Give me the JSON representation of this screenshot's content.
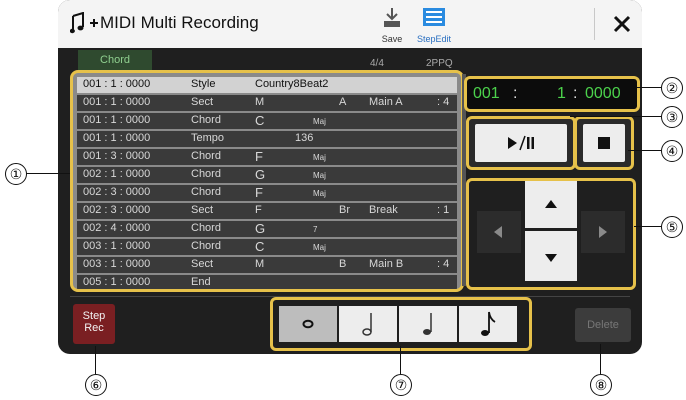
{
  "title": "MIDI Multi Recording",
  "toolbar": {
    "save_label": "Save",
    "stepedit_label": "StepEdit"
  },
  "chord_tab": "Chord",
  "time_signature": "4/4",
  "ppq": "2PPQ",
  "events": [
    {
      "pos": "001 : 1 : 0000",
      "type": "Style",
      "v1": "Country8Beat2",
      "v2": "",
      "v3": "",
      "v4": ""
    },
    {
      "pos": "001 : 1 : 0000",
      "type": "Sect",
      "v1": "M",
      "v2": "A",
      "v3": "Main A",
      "v4": ": 4"
    },
    {
      "pos": "001 : 1 : 0000",
      "type": "Chord",
      "v1": "C",
      "v2": "Maj",
      "v3": "",
      "v4": ""
    },
    {
      "pos": "001 : 1 : 0000",
      "type": "Tempo",
      "v1": "136",
      "v2": "",
      "v3": "",
      "v4": ""
    },
    {
      "pos": "001 : 3 : 0000",
      "type": "Chord",
      "v1": "F",
      "v2": "Maj",
      "v3": "",
      "v4": ""
    },
    {
      "pos": "002 : 1 : 0000",
      "type": "Chord",
      "v1": "G",
      "v2": "Maj",
      "v3": "",
      "v4": ""
    },
    {
      "pos": "002 : 3 : 0000",
      "type": "Chord",
      "v1": "F",
      "v2": "Maj",
      "v3": "",
      "v4": ""
    },
    {
      "pos": "002 : 3 : 0000",
      "type": "Sect",
      "v1": "F",
      "v2": "Br",
      "v3": "Break",
      "v4": ": 1"
    },
    {
      "pos": "002 : 4 : 0000",
      "type": "Chord",
      "v1": "G",
      "v2": "7",
      "v3": "",
      "v4": ""
    },
    {
      "pos": "003 : 1 : 0000",
      "type": "Chord",
      "v1": "C",
      "v2": "Maj",
      "v3": "",
      "v4": ""
    },
    {
      "pos": "003 : 1 : 0000",
      "type": "Sect",
      "v1": "M",
      "v2": "B",
      "v3": "Main B",
      "v4": ": 4"
    },
    {
      "pos": "005 : 1 : 0000",
      "type": "End",
      "v1": "",
      "v2": "",
      "v3": "",
      "v4": ""
    }
  ],
  "counter": {
    "measure": "001",
    "beat": "1",
    "clock": "0000"
  },
  "step_rec_label": [
    "Step",
    "Rec"
  ],
  "delete_label": "Delete",
  "callouts": [
    "①",
    "②",
    "③",
    "④",
    "⑤",
    "⑥",
    "⑦",
    "⑧"
  ],
  "colors": {
    "highlight": "#e6c14a",
    "counter_text": "#4cd24c",
    "step_rec_bg": "#7a1f22",
    "chord_tab": "#2f4a2f"
  }
}
